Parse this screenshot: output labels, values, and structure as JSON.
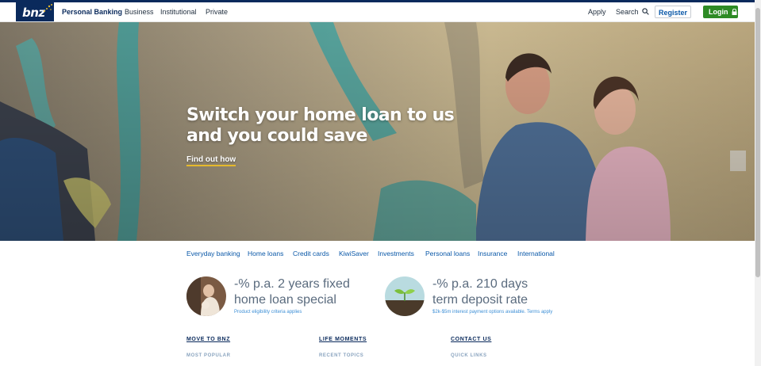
{
  "header": {
    "logo_text": "bnz",
    "nav": [
      "Personal Banking",
      "Business",
      "Institutional",
      "Private"
    ],
    "apply": "Apply",
    "search": "Search",
    "register": "Register",
    "login": "Login"
  },
  "hero": {
    "headline_line1": "Switch your home loan to us",
    "headline_line2": "and you could save",
    "cta": "Find out how"
  },
  "categories": [
    "Everyday banking",
    "Home loans",
    "Credit cards",
    "KiwiSaver",
    "Investments",
    "Personal loans",
    "Insurance",
    "International"
  ],
  "promos": [
    {
      "title_line1": "-% p.a. 2 years fixed",
      "title_line2": "home loan special",
      "sub": "Product eligibility criteria applies"
    },
    {
      "title_line1": "-% p.a. 210 days",
      "title_line2": "term deposit rate",
      "sub": "$2k-$5m interest payment options available. Terms apply"
    }
  ],
  "footer": {
    "columns": [
      {
        "heading": "MOVE TO BNZ",
        "sub": "MOST POPULAR"
      },
      {
        "heading": "LIFE MOMENTS",
        "sub": "RECENT TOPICS"
      },
      {
        "heading": "CONTACT US",
        "sub": "QUICK LINKS"
      }
    ]
  },
  "colors": {
    "brand_navy": "#0a2a5c",
    "login_green": "#2e8b25",
    "link_blue": "#0a58a8",
    "cta_underline": "#e5b92c"
  },
  "icons": {
    "search": "search-icon",
    "lock": "lock-icon",
    "stars": "stars-icon"
  }
}
